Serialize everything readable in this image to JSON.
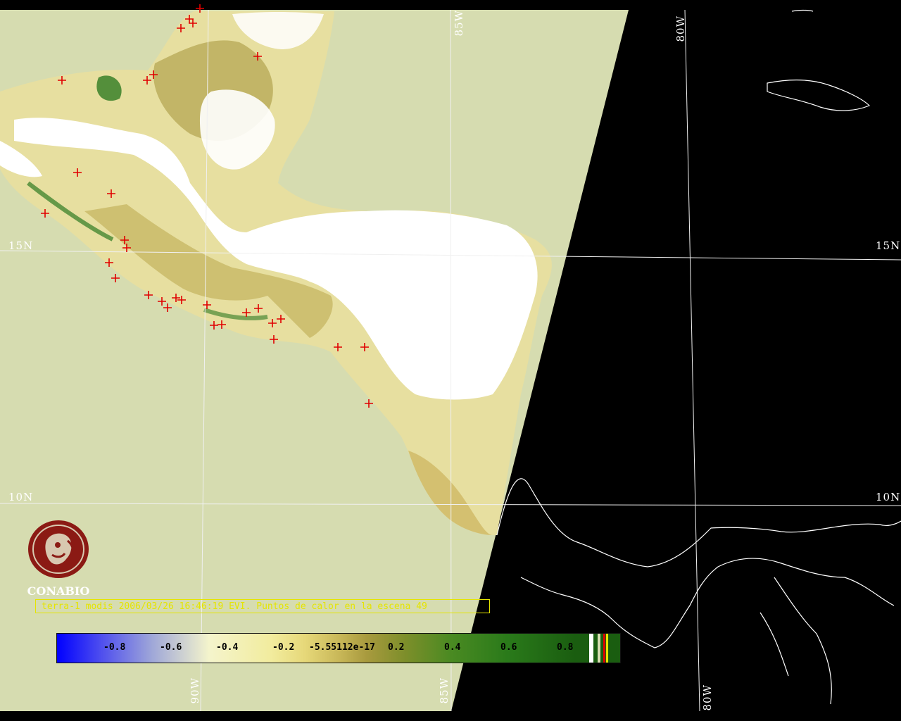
{
  "map": {
    "graticule_labels": {
      "lon_top_85": "85W",
      "lon_top_80": "80W",
      "lon_bottom_90": "90W",
      "lon_bottom_85": "85W",
      "lon_bottom_80": "80W",
      "lat_15_left": "15N",
      "lat_15_right": "15N",
      "lat_10_left": "10N",
      "lat_10_right": "10N"
    },
    "colors": {
      "background": "#000000",
      "swath": "#d6dcb0",
      "cloud": "#ffffff",
      "graticule": "#f0f0f0",
      "hotspot": "#e00000",
      "coastline": "#ffffff"
    },
    "hotspot_count": 49
  },
  "logo": {
    "name": "CONABIO",
    "color": "#8b1a14",
    "icon": "conabio-logo-icon"
  },
  "caption": {
    "text": "terra-1 modis 2006/03/26 16:46:19 EVI. Puntos de calor en la escena 49",
    "color": "#e5e500"
  },
  "colorbar": {
    "ticks": [
      "-0.8",
      "-0.6",
      "-0.4",
      "-0.2",
      "-5.55112e-17",
      "0.2",
      "0.4",
      "0.6",
      "0.8"
    ]
  }
}
